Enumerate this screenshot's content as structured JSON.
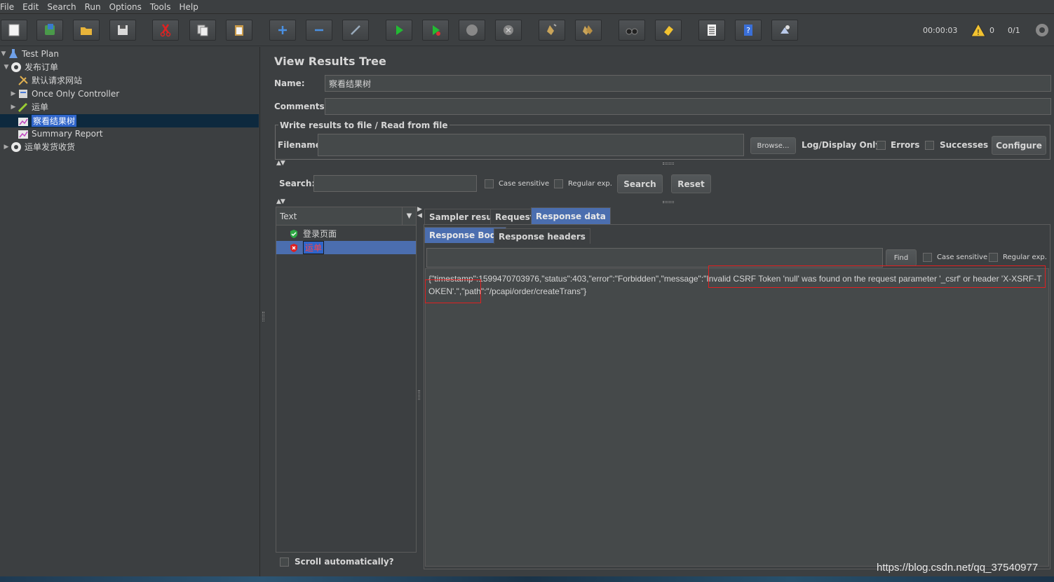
{
  "menu": [
    "File",
    "Edit",
    "Search",
    "Run",
    "Options",
    "Tools",
    "Help"
  ],
  "toolbar": {
    "timer": "00:00:03",
    "warnings": "0",
    "threads": "0/1"
  },
  "tree": {
    "items": [
      {
        "label": "Test Plan"
      },
      {
        "label": "发布订单"
      },
      {
        "label": "默认请求网站"
      },
      {
        "label": "Once Only Controller"
      },
      {
        "label": "运单"
      },
      {
        "label": "察看结果树"
      },
      {
        "label": "Summary Report"
      },
      {
        "label": "运单发货收货"
      }
    ]
  },
  "panel": {
    "title": "View Results Tree",
    "name_label": "Name:",
    "name_value": "察看结果树",
    "comments_label": "Comments:",
    "comments_value": "",
    "file_group_title": "Write results to file / Read from file",
    "filename_label": "Filename",
    "filename_value": "",
    "browse_label": "Browse...",
    "log_display_label": "Log/Display Only:",
    "errors_label": "Errors",
    "successes_label": "Successes",
    "configure_label": "Configure"
  },
  "search": {
    "label": "Search:",
    "value": "",
    "case_sensitive": "Case sensitive",
    "regular_exp": "Regular exp.",
    "search_button": "Search",
    "reset_button": "Reset"
  },
  "results": {
    "renderer": "Text",
    "samples": [
      {
        "label": "登录页面",
        "status": "success"
      },
      {
        "label": "运单",
        "status": "error"
      }
    ],
    "scroll_auto": "Scroll automatically?"
  },
  "tabs": [
    "Sampler result",
    "Request",
    "Response data"
  ],
  "subtabs": [
    "Response Body",
    "Response headers"
  ],
  "find": {
    "value": "",
    "find_button": "Find",
    "case_sensitive": "Case sensitive",
    "regular_exp": "Regular exp."
  },
  "response_body": "{\"timestamp\":1599470703976,\"status\":403,\"error\":\"Forbidden\",\"message\":\"Invalid CSRF Token 'null' was found on the request parameter '_csrf' or header 'X-XSRF-TOKEN'.\",\"path\":\"/pcapi/order/createTrans\"}",
  "watermark": "https://blog.csdn.net/qq_37540977",
  "colors": {
    "background": "#3c3f41",
    "selection": "#4b6eaf",
    "error": "#ff4444",
    "highlight_box": "#e02020"
  }
}
